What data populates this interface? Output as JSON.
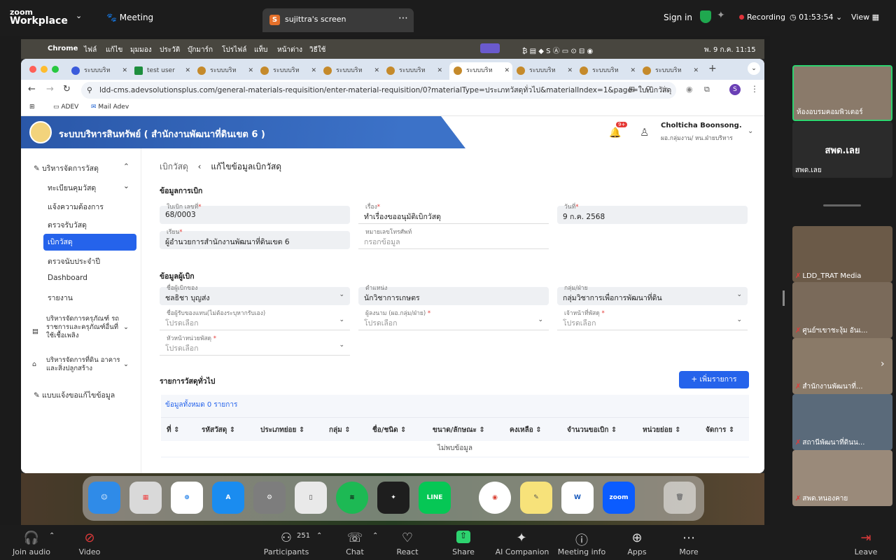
{
  "zoom": {
    "logo_line1": "zoom",
    "logo_line2": "Workplace",
    "meeting_label": "Meeting",
    "share_tab": "sujittra's screen",
    "signin": "Sign in",
    "recording": "Recording",
    "timer": "01:53:54",
    "view": "View"
  },
  "mac_menu": {
    "app": "Chrome",
    "items": [
      "ไฟล์",
      "แก้ไข",
      "มุมมอง",
      "ประวัติ",
      "บุ๊กมาร์ก",
      "โปรไฟล์",
      "แท็บ",
      "หน้าต่าง",
      "วิธีใช้"
    ],
    "clock": "พ. 9 ก.ค. 11:15"
  },
  "browser": {
    "tabs": [
      "ระบบบริห",
      "test user",
      "ระบบบริห",
      "ระบบบริห",
      "ระบบบริห",
      "ระบบบริห",
      "ระบบบริห",
      "ระบบบริห",
      "ระบบบริห",
      "ระบบบริห"
    ],
    "url": "ldd-cms.adevsolutionsplus.com/general-materials-requisition/enter-material-requisition/0?materialType=ประเภทวัสดุทั่วไป&materialIndex=1&page=ใบเบิกวัสดุ",
    "bookmarks": [
      "ADEV",
      "Mail Adev"
    ],
    "profile_initial": "S"
  },
  "app": {
    "title": "ระบบบริหารสินทรัพย์ ( สำนักงานพัฒนาที่ดินเขต 6 )",
    "notif_count": "9+",
    "user_name": "Cholticha Boonsong.",
    "user_role": "ผอ.กลุ่มงาน/ หน.ฝ่ายบริหาร"
  },
  "sidebar": {
    "items": [
      {
        "label": "บริหารจัดการวัสดุ"
      },
      {
        "label": "ทะเบียนคุมวัสดุ"
      },
      {
        "label": "แจ้งความต้องการ"
      },
      {
        "label": "ตรวจรับวัสดุ"
      },
      {
        "label": "เบิกวัสดุ"
      },
      {
        "label": "ตรวจนับประจำปี"
      },
      {
        "label": "Dashboard"
      },
      {
        "label": "รายงาน"
      },
      {
        "label": "บริหารจัดการครุภัณฑ์ รถราชการและครุภัณฑ์อื่นที่ใช้เชื้อเพลิง"
      },
      {
        "label": "บริหารจัดการที่ดิน อาคารและสิ่งปลูกสร้าง"
      },
      {
        "label": "แบบแจ้งขอแก้ไขข้อมูล"
      }
    ]
  },
  "page": {
    "breadcrumb_root": "เบิกวัสดุ",
    "breadcrumb_current": "แก้ไขข้อมูลเบิกวัสดุ",
    "section1": "ข้อมูลการเบิก",
    "f_doc_label": "ใบเบิก เลขที่",
    "f_doc_value": "68/0003",
    "f_subject_label": "เรื่อง",
    "f_subject_value": "ทำเรื่องขออนุมัติเบิกวัสดุ",
    "f_date_label": "วันที่",
    "f_date_value": "9 ก.ค. 2568",
    "f_to_label": "เรียน",
    "f_to_value": "ผู้อำนวยการสำนักงานพัฒนาที่ดินเขต 6",
    "f_phone_label": "หมายเลขโทรศัพท์",
    "f_phone_placeholder": "กรอกข้อมูล",
    "section2": "ข้อมูลผู้เบิก",
    "f_req_label": "ชื่อผู้เบิกของ",
    "f_req_value": "ชลธิชา บุญส่ง",
    "f_pos_label": "ตำแหน่ง",
    "f_pos_value": "นักวิชาการเกษตร",
    "f_group_label": "กลุ่ม/ฝ่าย",
    "f_group_value": "กลุ่มวิชาการเพื่อการพัฒนาที่ดิน",
    "f_recv_label": "ชื่อผู้รับของแทน(ไม่ต้องระบุหากรับเอง)",
    "f_recv_placeholder": "โปรดเลือก",
    "f_head_label": "ผู้ลงนาม (ผอ.กลุ่ม/ฝ่าย)",
    "f_head_placeholder": "โปรดเลือก",
    "f_officer_label": "เจ้าหน้าที่พัสดุ",
    "f_officer_placeholder": "โปรดเลือก",
    "f_chief_label": "หัวหน้าหน่วยพัสดุ",
    "f_chief_placeholder": "โปรดเลือก",
    "section3": "รายการวัสดุทั่วไป",
    "add_button": "+ เพิ่มรายการ",
    "total": "ข้อมูลทั้งหมด 0 รายการ",
    "columns": [
      "ที่",
      "รหัสวัสดุ",
      "ประเภทย่อย",
      "กลุ่ม",
      "ชื่อ/ชนิด",
      "ขนาด/ลักษณะ",
      "คงเหลือ",
      "จำนวนขอเบิก",
      "หน่วยย่อย",
      "จัดการ"
    ],
    "no_data": "ไม่พบข้อมูล"
  },
  "dock": [
    "Finder",
    "Launchpad",
    "Safari",
    "App Store",
    "Settings",
    "iPhone Mirroring",
    "Spotify",
    "Figma",
    "LINE",
    "Chrome",
    "Notes",
    "Word",
    "zoom",
    "Trash"
  ],
  "participants": [
    {
      "name": "ห้องอบรมคอมพิวเตอร์"
    },
    {
      "name": "สพด.เลย",
      "label": "สพด.เลย"
    },
    {
      "name": "LDD_TRAT Media"
    },
    {
      "name": "ศูนย์ฯเขาชะงุ้ม อันเ..."
    },
    {
      "name": "สำนักงานพัฒนาที่..."
    },
    {
      "name": "สถานีพัฒนาที่ดินน..."
    },
    {
      "name": "สพด.หนองคาย"
    }
  ],
  "bottom": {
    "join_audio": "Join audio",
    "video": "Video",
    "participants": "Participants",
    "participants_count": "251",
    "chat": "Chat",
    "react": "React",
    "share": "Share",
    "ai": "AI Companion",
    "info": "Meeting info",
    "apps": "Apps",
    "more": "More",
    "leave": "Leave"
  }
}
